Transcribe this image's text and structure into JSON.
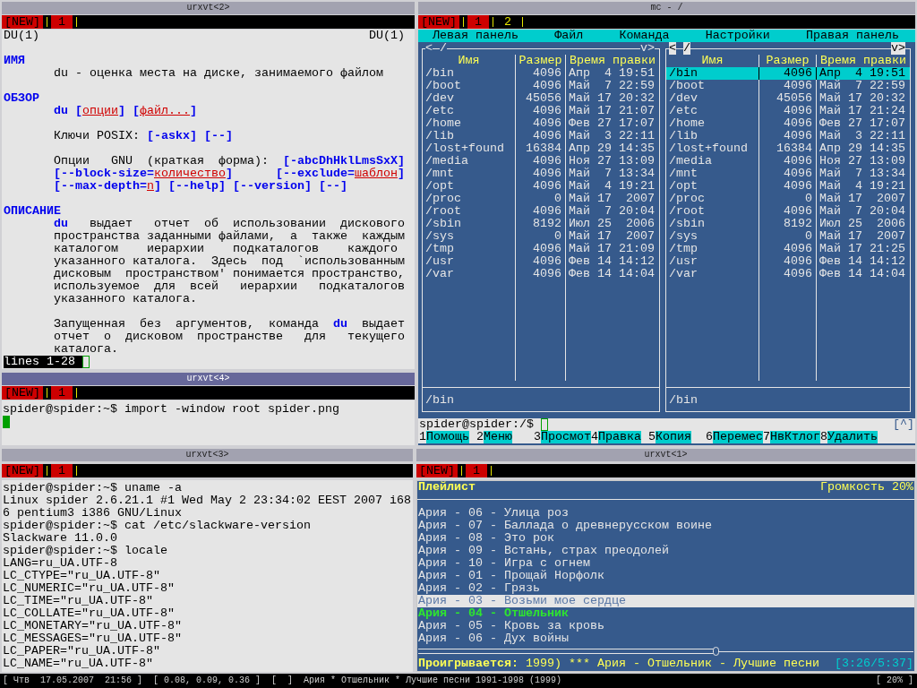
{
  "man_window": {
    "title": "urxvt<2>",
    "active": false,
    "new_button": "[NEW]",
    "tabs": [
      {
        "label": "1",
        "selected": true
      }
    ],
    "header_left": "DU(1)",
    "header_right": "DU(1)",
    "sections": [
      {
        "heading": "ИМЯ",
        "paragraphs": [
          [
            [
              {
                "kind": "plain",
                "text": "du - оценка места на диске, занимаемого файлом"
              }
            ]
          ]
        ]
      },
      {
        "heading": "ОБЗОР",
        "paragraphs": [
          [
            [
              {
                "kind": "bold",
                "text": "du ["
              },
              {
                "kind": "arg",
                "text": "опции"
              },
              {
                "kind": "bold",
                "text": "] ["
              },
              {
                "kind": "arg",
                "text": "файл..."
              },
              {
                "kind": "bold",
                "text": "]"
              }
            ]
          ],
          [
            [
              {
                "kind": "plain",
                "text": "Ключи POSIX: "
              },
              {
                "kind": "bold",
                "text": "[-askx] [--]"
              }
            ]
          ],
          [
            [
              {
                "kind": "plain",
                "text": "Опции   GNU  (краткая  форма):  "
              },
              {
                "kind": "bold",
                "text": "[-abcDhHklLmsSxX]"
              }
            ],
            [
              {
                "kind": "bold",
                "text": "[--block-size="
              },
              {
                "kind": "arg",
                "text": "количество"
              },
              {
                "kind": "bold",
                "text": "]      [--exclude="
              },
              {
                "kind": "arg",
                "text": "шаблон"
              },
              {
                "kind": "bold",
                "text": "]"
              }
            ],
            [
              {
                "kind": "bold",
                "text": "[--max-depth="
              },
              {
                "kind": "arg",
                "text": "n"
              },
              {
                "kind": "bold",
                "text": "] [--help] [--version] [--]"
              }
            ]
          ]
        ]
      },
      {
        "heading": "ОПИСАНИЕ",
        "paragraphs": [
          [
            [
              {
                "kind": "bold",
                "text": "du"
              },
              {
                "kind": "plain",
                "text": "   выдает   отчет  об  использовании  дискового"
              }
            ],
            [
              {
                "kind": "plain",
                "text": "пространства заданными файлами,  а  также  каждым"
              }
            ],
            [
              {
                "kind": "plain",
                "text": "каталогом    иерархии    подкаталогов    каждого"
              }
            ],
            [
              {
                "kind": "plain",
                "text": "указанного каталога.  Здесь  под  `использованным"
              }
            ],
            [
              {
                "kind": "plain",
                "text": "дисковым  пространством' понимается пространство,"
              }
            ],
            [
              {
                "kind": "plain",
                "text": "используемое  для  всей   иерархии   подкаталогов"
              }
            ],
            [
              {
                "kind": "plain",
                "text": "указанного каталога."
              }
            ]
          ],
          [
            [
              {
                "kind": "plain",
                "text": "Запущенная  без  аргументов,  команда  "
              },
              {
                "kind": "bold",
                "text": "du"
              },
              {
                "kind": "plain",
                "text": "  выдает"
              }
            ],
            [
              {
                "kind": "plain",
                "text": "отчет  о  дисковом  пространстве   для   текущего"
              }
            ],
            [
              {
                "kind": "plain",
                "text": "каталога."
              }
            ]
          ]
        ]
      }
    ],
    "status": "lines 1-28"
  },
  "file_manager_window": {
    "title": "mc - /",
    "active": false,
    "new_button": "[NEW]",
    "tabs": [
      {
        "label": "1",
        "selected": true
      },
      {
        "label": "2",
        "selected": false
      }
    ],
    "menu": [
      "Левая панель",
      "Файл",
      "Команда",
      "Настройки",
      "Правая панель"
    ],
    "panels": [
      {
        "active": false,
        "nav_left": "<",
        "path": "/",
        "nav_right": "v>",
        "columns": [
          "Имя",
          "Размер",
          "Время правки"
        ],
        "rows": [
          {
            "name": "/bin",
            "size": "4096",
            "modified": "Апр  4 19:51",
            "selected": false
          },
          {
            "name": "/boot",
            "size": "4096",
            "modified": "Май  7 22:59",
            "selected": false
          },
          {
            "name": "/dev",
            "size": "45056",
            "modified": "Май 17 20:32",
            "selected": false
          },
          {
            "name": "/etc",
            "size": "4096",
            "modified": "Май 17 21:07",
            "selected": false
          },
          {
            "name": "/home",
            "size": "4096",
            "modified": "Фев 27 17:07",
            "selected": false
          },
          {
            "name": "/lib",
            "size": "4096",
            "modified": "Май  3 22:11",
            "selected": false
          },
          {
            "name": "/lost+found",
            "size": "16384",
            "modified": "Апр 29 14:35",
            "selected": false
          },
          {
            "name": "/media",
            "size": "4096",
            "modified": "Ноя 27 13:09",
            "selected": false
          },
          {
            "name": "/mnt",
            "size": "4096",
            "modified": "Май  7 13:34",
            "selected": false
          },
          {
            "name": "/opt",
            "size": "4096",
            "modified": "Май  4 19:21",
            "selected": false
          },
          {
            "name": "/proc",
            "size": "0",
            "modified": "Май 17  2007",
            "selected": false
          },
          {
            "name": "/root",
            "size": "4096",
            "modified": "Май  7 20:04",
            "selected": false
          },
          {
            "name": "/sbin",
            "size": "8192",
            "modified": "Июл 25  2006",
            "selected": false
          },
          {
            "name": "/sys",
            "size": "0",
            "modified": "Май 17  2007",
            "selected": false
          },
          {
            "name": "/tmp",
            "size": "4096",
            "modified": "Май 17 21:09",
            "selected": false
          },
          {
            "name": "/usr",
            "size": "4096",
            "modified": "Фев 14 14:12",
            "selected": false
          },
          {
            "name": "/var",
            "size": "4096",
            "modified": "Фев 14 14:04",
            "selected": false
          }
        ],
        "mini_status": "/bin"
      },
      {
        "active": true,
        "nav_left": "<",
        "path": "/",
        "nav_right": "v>",
        "columns": [
          "Имя",
          "Размер",
          "Время правки"
        ],
        "rows": [
          {
            "name": "/bin",
            "size": "4096",
            "modified": "Апр  4 19:51",
            "selected": true
          },
          {
            "name": "/boot",
            "size": "4096",
            "modified": "Май  7 22:59",
            "selected": false
          },
          {
            "name": "/dev",
            "size": "45056",
            "modified": "Май 17 20:32",
            "selected": false
          },
          {
            "name": "/etc",
            "size": "4096",
            "modified": "Май 17 21:24",
            "selected": false
          },
          {
            "name": "/home",
            "size": "4096",
            "modified": "Фев 27 17:07",
            "selected": false
          },
          {
            "name": "/lib",
            "size": "4096",
            "modified": "Май  3 22:11",
            "selected": false
          },
          {
            "name": "/lost+found",
            "size": "16384",
            "modified": "Апр 29 14:35",
            "selected": false
          },
          {
            "name": "/media",
            "size": "4096",
            "modified": "Ноя 27 13:09",
            "selected": false
          },
          {
            "name": "/mnt",
            "size": "4096",
            "modified": "Май  7 13:34",
            "selected": false
          },
          {
            "name": "/opt",
            "size": "4096",
            "modified": "Май  4 19:21",
            "selected": false
          },
          {
            "name": "/proc",
            "size": "0",
            "modified": "Май 17  2007",
            "selected": false
          },
          {
            "name": "/root",
            "size": "4096",
            "modified": "Май  7 20:04",
            "selected": false
          },
          {
            "name": "/sbin",
            "size": "8192",
            "modified": "Июл 25  2006",
            "selected": false
          },
          {
            "name": "/sys",
            "size": "0",
            "modified": "Май 17  2007",
            "selected": false
          },
          {
            "name": "/tmp",
            "size": "4096",
            "modified": "Май 17 21:25",
            "selected": false
          },
          {
            "name": "/usr",
            "size": "4096",
            "modified": "Фев 14 14:12",
            "selected": false
          },
          {
            "name": "/var",
            "size": "4096",
            "modified": "Фев 14 14:04",
            "selected": false
          }
        ],
        "mini_status": "/bin"
      }
    ],
    "prompt": "spider@spider:/$",
    "history_button": "[^]",
    "keys": [
      {
        "number": "1",
        "label": "Помощь"
      },
      {
        "number": "2",
        "label": "Меню"
      },
      {
        "number": "3",
        "label": "Просмот"
      },
      {
        "number": "4",
        "label": "Правка"
      },
      {
        "number": "5",
        "label": "Копия"
      },
      {
        "number": "6",
        "label": "Перемес"
      },
      {
        "number": "7",
        "label": "НвКтлог"
      },
      {
        "number": "8",
        "label": "Удалить"
      }
    ]
  },
  "shell_window": {
    "title": "urxvt<4>",
    "active": true,
    "new_button": "[NEW]",
    "tabs": [
      {
        "label": "1",
        "selected": true
      }
    ],
    "lines": [
      "spider@spider:~$ import -window root spider.png"
    ]
  },
  "terminal_window": {
    "title": "urxvt<3>",
    "active": false,
    "new_button": "[NEW]",
    "tabs": [
      {
        "label": "1",
        "selected": true
      }
    ],
    "lines": [
      "spider@spider:~$ uname -a",
      "Linux spider 2.6.21.1 #1 Wed May 2 23:34:02 EEST 2007 i68",
      "6 pentium3 i386 GNU/Linux",
      "spider@spider:~$ cat /etc/slackware-version",
      "Slackware 11.0.0",
      "spider@spider:~$ locale",
      "LANG=ru_UA.UTF-8",
      "LC_CTYPE=\"ru_UA.UTF-8\"",
      "LC_NUMERIC=\"ru_UA.UTF-8\"",
      "LC_TIME=\"ru_UA.UTF-8\"",
      "LC_COLLATE=\"ru_UA.UTF-8\"",
      "LC_MONETARY=\"ru_UA.UTF-8\"",
      "LC_MESSAGES=\"ru_UA.UTF-8\"",
      "LC_PAPER=\"ru_UA.UTF-8\"",
      "LC_NAME=\"ru_UA.UTF-8\""
    ]
  },
  "player_window": {
    "title": "urxvt<1>",
    "active": false,
    "new_button": "[NEW]",
    "tabs": [
      {
        "label": "1",
        "selected": true
      }
    ],
    "playlist_title": "Плейлист",
    "volume": "Громкость 20%",
    "tracks": [
      {
        "text": "Ария - 06 - Улица роз",
        "selected": false,
        "playing": false
      },
      {
        "text": "Ария - 07 - Баллада о древнерусском воине",
        "selected": false,
        "playing": false
      },
      {
        "text": "Ария - 08 - Это рок",
        "selected": false,
        "playing": false
      },
      {
        "text": "Ария - 09 - Встань, страх преодолей",
        "selected": false,
        "playing": false
      },
      {
        "text": "Ария - 10 - Игра с огнем",
        "selected": false,
        "playing": false
      },
      {
        "text": "Ария - 01 - Прощай Норфолк",
        "selected": false,
        "playing": false
      },
      {
        "text": "Ария - 02 - Грязь",
        "selected": false,
        "playing": false
      },
      {
        "text": "Ария - 03 - Возьми мое сердце",
        "selected": true,
        "playing": false
      },
      {
        "text": "Ария - 04 - Отшельник",
        "selected": false,
        "playing": true
      },
      {
        "text": "Ария - 05 - Кровь за кровь",
        "selected": false,
        "playing": false
      },
      {
        "text": "Ария - 06 - Дух войны",
        "selected": false,
        "playing": false
      }
    ],
    "progress": {
      "level": 0.6
    },
    "now_playing_label": "Проигрывается:",
    "now_playing": "1999) *** Ария - Отшельник - Лучшие песни",
    "time": "[3:26/5:37]"
  },
  "status_bar": {
    "segments": [
      "[ Чтв  17.05.2007  21:56 ]",
      "[ 0.08, 0.09, 0.36 ]",
      "[  ]",
      "Ария * Отшельник * Лучшие песни 1991-1998 (1999)"
    ],
    "right": "[ 20% ]"
  }
}
